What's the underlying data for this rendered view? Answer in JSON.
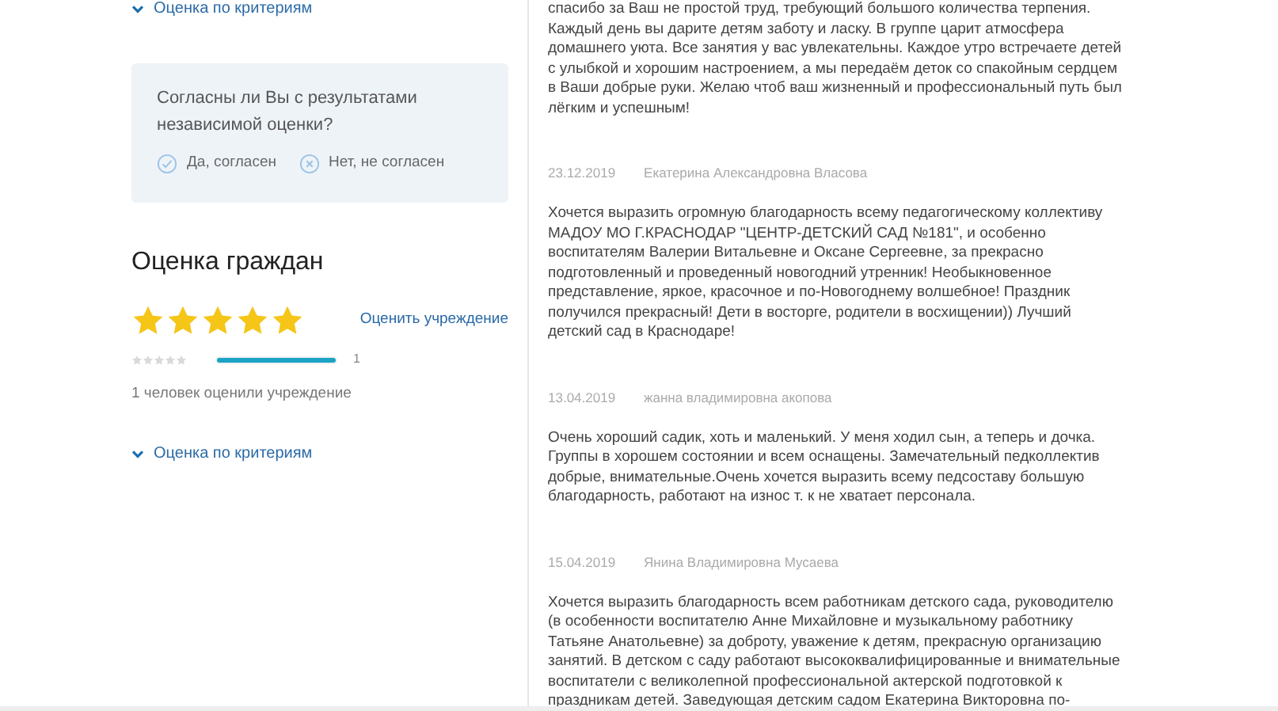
{
  "sidebar": {
    "criteria_link_top": "Оценка по критериям",
    "agreement": {
      "question": "Согласны ли Вы с результатами независимой оценки?",
      "options": [
        {
          "kind": "yes",
          "label": "Да, согласен"
        },
        {
          "kind": "no",
          "label": "Нет, не согласен"
        }
      ]
    },
    "citizen_rating": {
      "title": "Оценка граждан",
      "stars": 5,
      "rate_link": "Оценить учреждение",
      "breakdown": [
        {
          "stars": 0,
          "level": 1,
          "count": "1"
        }
      ],
      "summary": "1 человек оценили учреждение"
    },
    "criteria_link_bottom": "Оценка по критериям"
  },
  "reviews": [
    {
      "lines": [
        "спасибо за Ваш не простой труд, требующий большого количества терпения.",
        "Каждый день вы дарите детям заботу и ласку. В группе царит атмосфера",
        "домашнего уюта. Все занятия у вас увлекательны. Каждое утро встречаете детей",
        "с улыбкой и хорошим настроением, а мы передаём деток со спакойным сердцем",
        "в Ваши добрые руки. Желаю чтоб ваш жизненный и профессиональный путь был",
        "лёгким и успешным!"
      ]
    },
    {
      "date": "23.12.2019",
      "author": "Екатерина Александровна Власова",
      "lines": [
        "Хочется выразить огромную благодарность всему педагогическому коллективу",
        "МАДОУ МО Г.КРАСНОДАР \"ЦЕНТР-ДЕТСКИЙ САД №181\", и особенно",
        "воспитателям Валерии Витальевне и Оксане Сергеевне, за прекрасно",
        "подготовленный и проведенный новогодний утренник! Необыкновенное",
        "представление, яркое, красочное и по-Новогоднему волшебное! Праздник",
        "получился прекрасный! Дети в восторге, родители в восхищении)) Лучший",
        "детский сад в Краснодаре!"
      ]
    },
    {
      "date": "13.04.2019",
      "author": "жанна владимировна акопова",
      "lines": [
        "Очень хороший садик, хоть и маленький. У меня ходил сын, а теперь и дочка.",
        "Группы в хорошем состоянии и всем оснащены. Замечательный педколлектив",
        "добрые, внимательные.Очень хочется выразить всему педсоставу большую",
        "благодарность, работают на износ т. к не хватает персонала."
      ]
    },
    {
      "date": "15.04.2019",
      "author": "Янина Владимировна Мусаева",
      "lines": [
        "Хочется выразить благодарность всем работникам детского сада, руководителю",
        "(в особенности воспитателю Анне Михайловне и музыкальному работнику",
        "Татьяне Анатольевне) за доброту, уважение к детям, прекрасную организацию",
        "занятий. В детском с саду работают высококвалифицированные и внимательные",
        "воспитатели с великолепной профессиональной актерской подготовкой к",
        "праздникам детей. Заведующая детским садом Екатерина Викторовна по-"
      ]
    }
  ]
}
